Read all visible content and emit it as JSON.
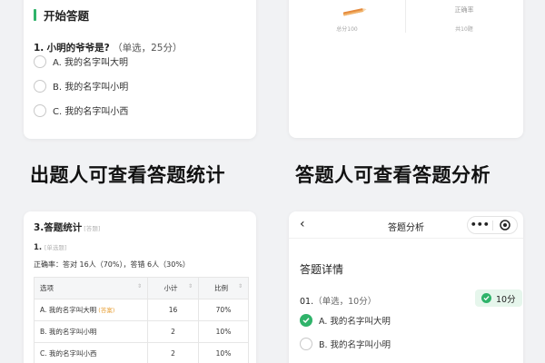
{
  "quiz_card": {
    "section_title": "开始答题",
    "question_number": "1.",
    "question_text": "小明的爷爷是?",
    "question_meta": "（单选，25分）",
    "options": [
      "A. 我的名字叫大明",
      "B. 我的名字叫小明",
      "C. 我的名字叫小西"
    ]
  },
  "score_card": {
    "accuracy_label": "正确率",
    "total_label": "总分100",
    "count_label": "共10题"
  },
  "headings": {
    "left": "出题人可查看答题统计",
    "right": "答题人可查看答题分析"
  },
  "stats_card": {
    "title": "3.答题统计",
    "title_tag": "[答题]",
    "question_number": "1.",
    "question_tag": "[单选题]",
    "accuracy_text": "正确率：答对 16人（70%），答错 6人（30%）",
    "columns": [
      "选项",
      "小计",
      "比例"
    ],
    "rows": [
      {
        "option": "A. 我的名字叫大明",
        "tag": "(答案)",
        "count": "16",
        "ratio": "70%"
      },
      {
        "option": "B. 我的名字叫小明",
        "tag": "",
        "count": "2",
        "ratio": "10%"
      },
      {
        "option": "C. 我的名字叫小西",
        "tag": "",
        "count": "2",
        "ratio": "10%"
      }
    ]
  },
  "analysis_card": {
    "nav_title": "答题分析",
    "back_icon": "‹",
    "more_icon": "•••",
    "section_title": "答题详情",
    "question_number": "01.",
    "question_meta": "（单选，10分）",
    "score": "10分",
    "options": [
      "A. 我的名字叫大明",
      "B. 我的名字叫小明"
    ]
  },
  "colors": {
    "accent_green": "#2fb36a",
    "answer_orange": "#e8a13a",
    "background": "#f1f2f4"
  }
}
